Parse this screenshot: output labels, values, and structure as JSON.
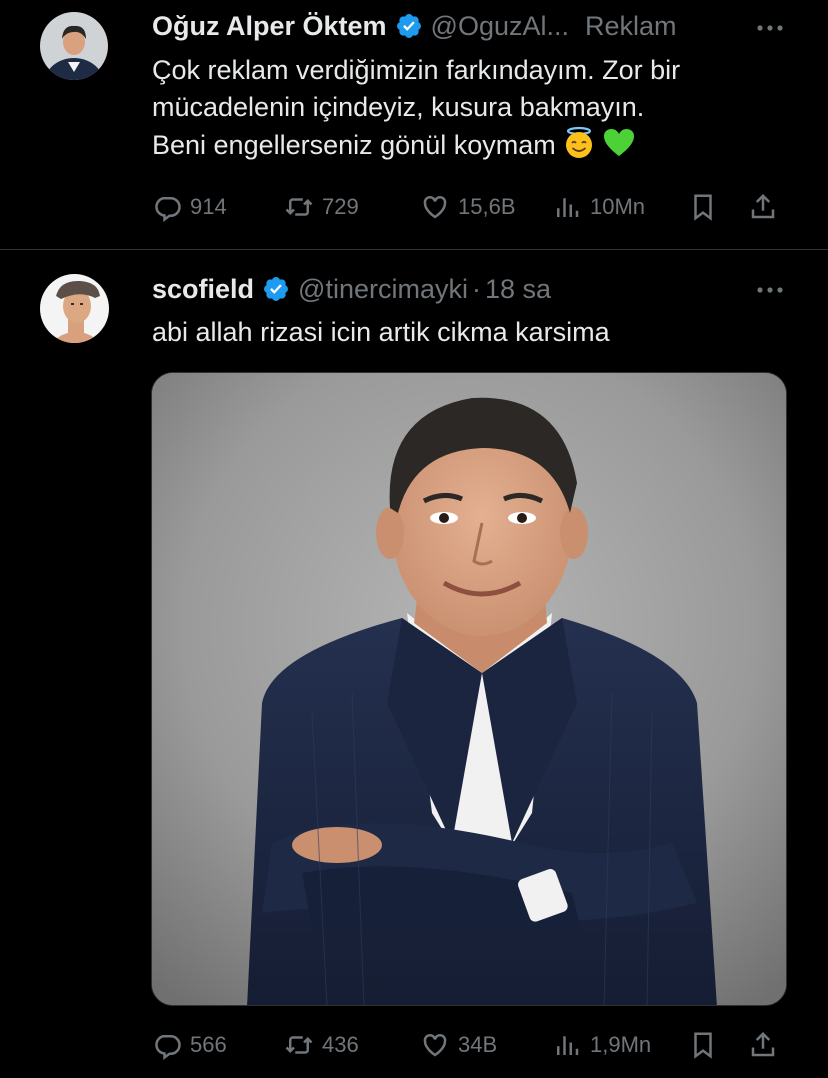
{
  "tweets": [
    {
      "display_name": "Oğuz Alper Öktem",
      "handle": "@OguzAl...",
      "ad_label": "Reklam",
      "text_lines": [
        "Çok reklam verdiğimizin farkındayım. Zor  bir",
        "mücadelenin içindeyiz, kusura bakmayın.",
        "Beni engellerseniz gönül koymam"
      ],
      "emojis": [
        "smiling-face-with-halo",
        "green-heart"
      ],
      "stats": {
        "replies": "914",
        "retweets": "729",
        "likes": "15,6B",
        "views": "10Mn"
      }
    },
    {
      "display_name": "scofield",
      "handle": "@tinercimayki",
      "separator": "·",
      "time": "18 sa",
      "text": "abi allah rizasi icin artik cikma karsima",
      "media": "portrait-man-navy-suit-arms-crossed",
      "stats": {
        "replies": "566",
        "retweets": "436",
        "likes": "34B",
        "views": "1,9Mn"
      }
    }
  ],
  "colors": {
    "background": "#000000",
    "text": "#e7e9ea",
    "muted": "#71767b",
    "verified": "#1d9bf0",
    "divider": "#2f3336"
  },
  "icons": [
    "reply-icon",
    "retweet-icon",
    "like-icon",
    "views-icon",
    "bookmark-icon",
    "share-icon",
    "more-icon",
    "verified-badge-icon"
  ]
}
